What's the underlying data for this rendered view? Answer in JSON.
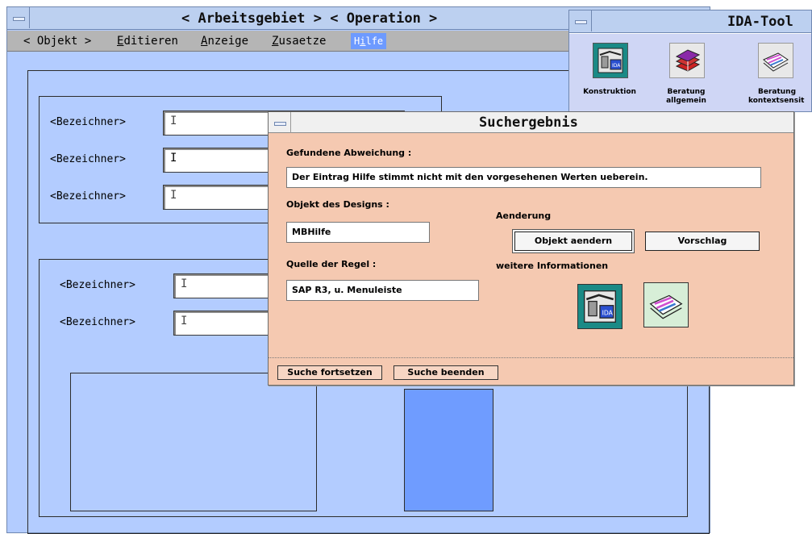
{
  "main_window": {
    "title": "< Arbeitsgebiet > < Operation >",
    "menu": [
      "< Objekt >",
      "Editieren",
      "Anzeige",
      "Zusaetze",
      "Hilfe"
    ],
    "selected_menu": "Hilfe",
    "field_labels_group1": [
      "<Bezeichner>",
      "<Bezeichner>",
      "<Bezeichner>"
    ],
    "field_labels_group2": [
      "<Bezeichner>",
      "<Bezeichner>"
    ]
  },
  "ida_tool": {
    "title": "IDA-Tool",
    "tools": [
      {
        "label_line1": "Konstruktion",
        "label_line2": "",
        "icon": "ida-construction-icon"
      },
      {
        "label_line1": "Beratung",
        "label_line2": "allgemein",
        "icon": "books-icon"
      },
      {
        "label_line1": "Beratung",
        "label_line2": "kontextsensit",
        "icon": "document-stack-icon"
      }
    ]
  },
  "dialog": {
    "title": "Suchergebnis",
    "deviation_label": "Gefundene Abweichung :",
    "deviation_text": "Der Eintrag Hilfe stimmt nicht mit den vorgesehenen Werten ueberein.",
    "design_object_label": "Objekt des Designs :",
    "design_object_value": "MBHilfe",
    "rule_source_label": "Quelle der Regel :",
    "rule_source_value": "SAP R3, u. Menuleiste",
    "change_label": "Aenderung",
    "change_object_button": "Objekt aendern",
    "suggestion_button": "Vorschlag",
    "more_info_label": "weitere Informationen",
    "continue_search_button": "Suche fortsetzen",
    "end_search_button": "Suche beenden"
  },
  "colors": {
    "main_bg": "#b3ccff",
    "dialog_bg": "#f5c9b1",
    "menu_highlight": "#6d9aff",
    "ida_bg": "#cfd6f5",
    "icon_teal": "#1a8a86"
  }
}
